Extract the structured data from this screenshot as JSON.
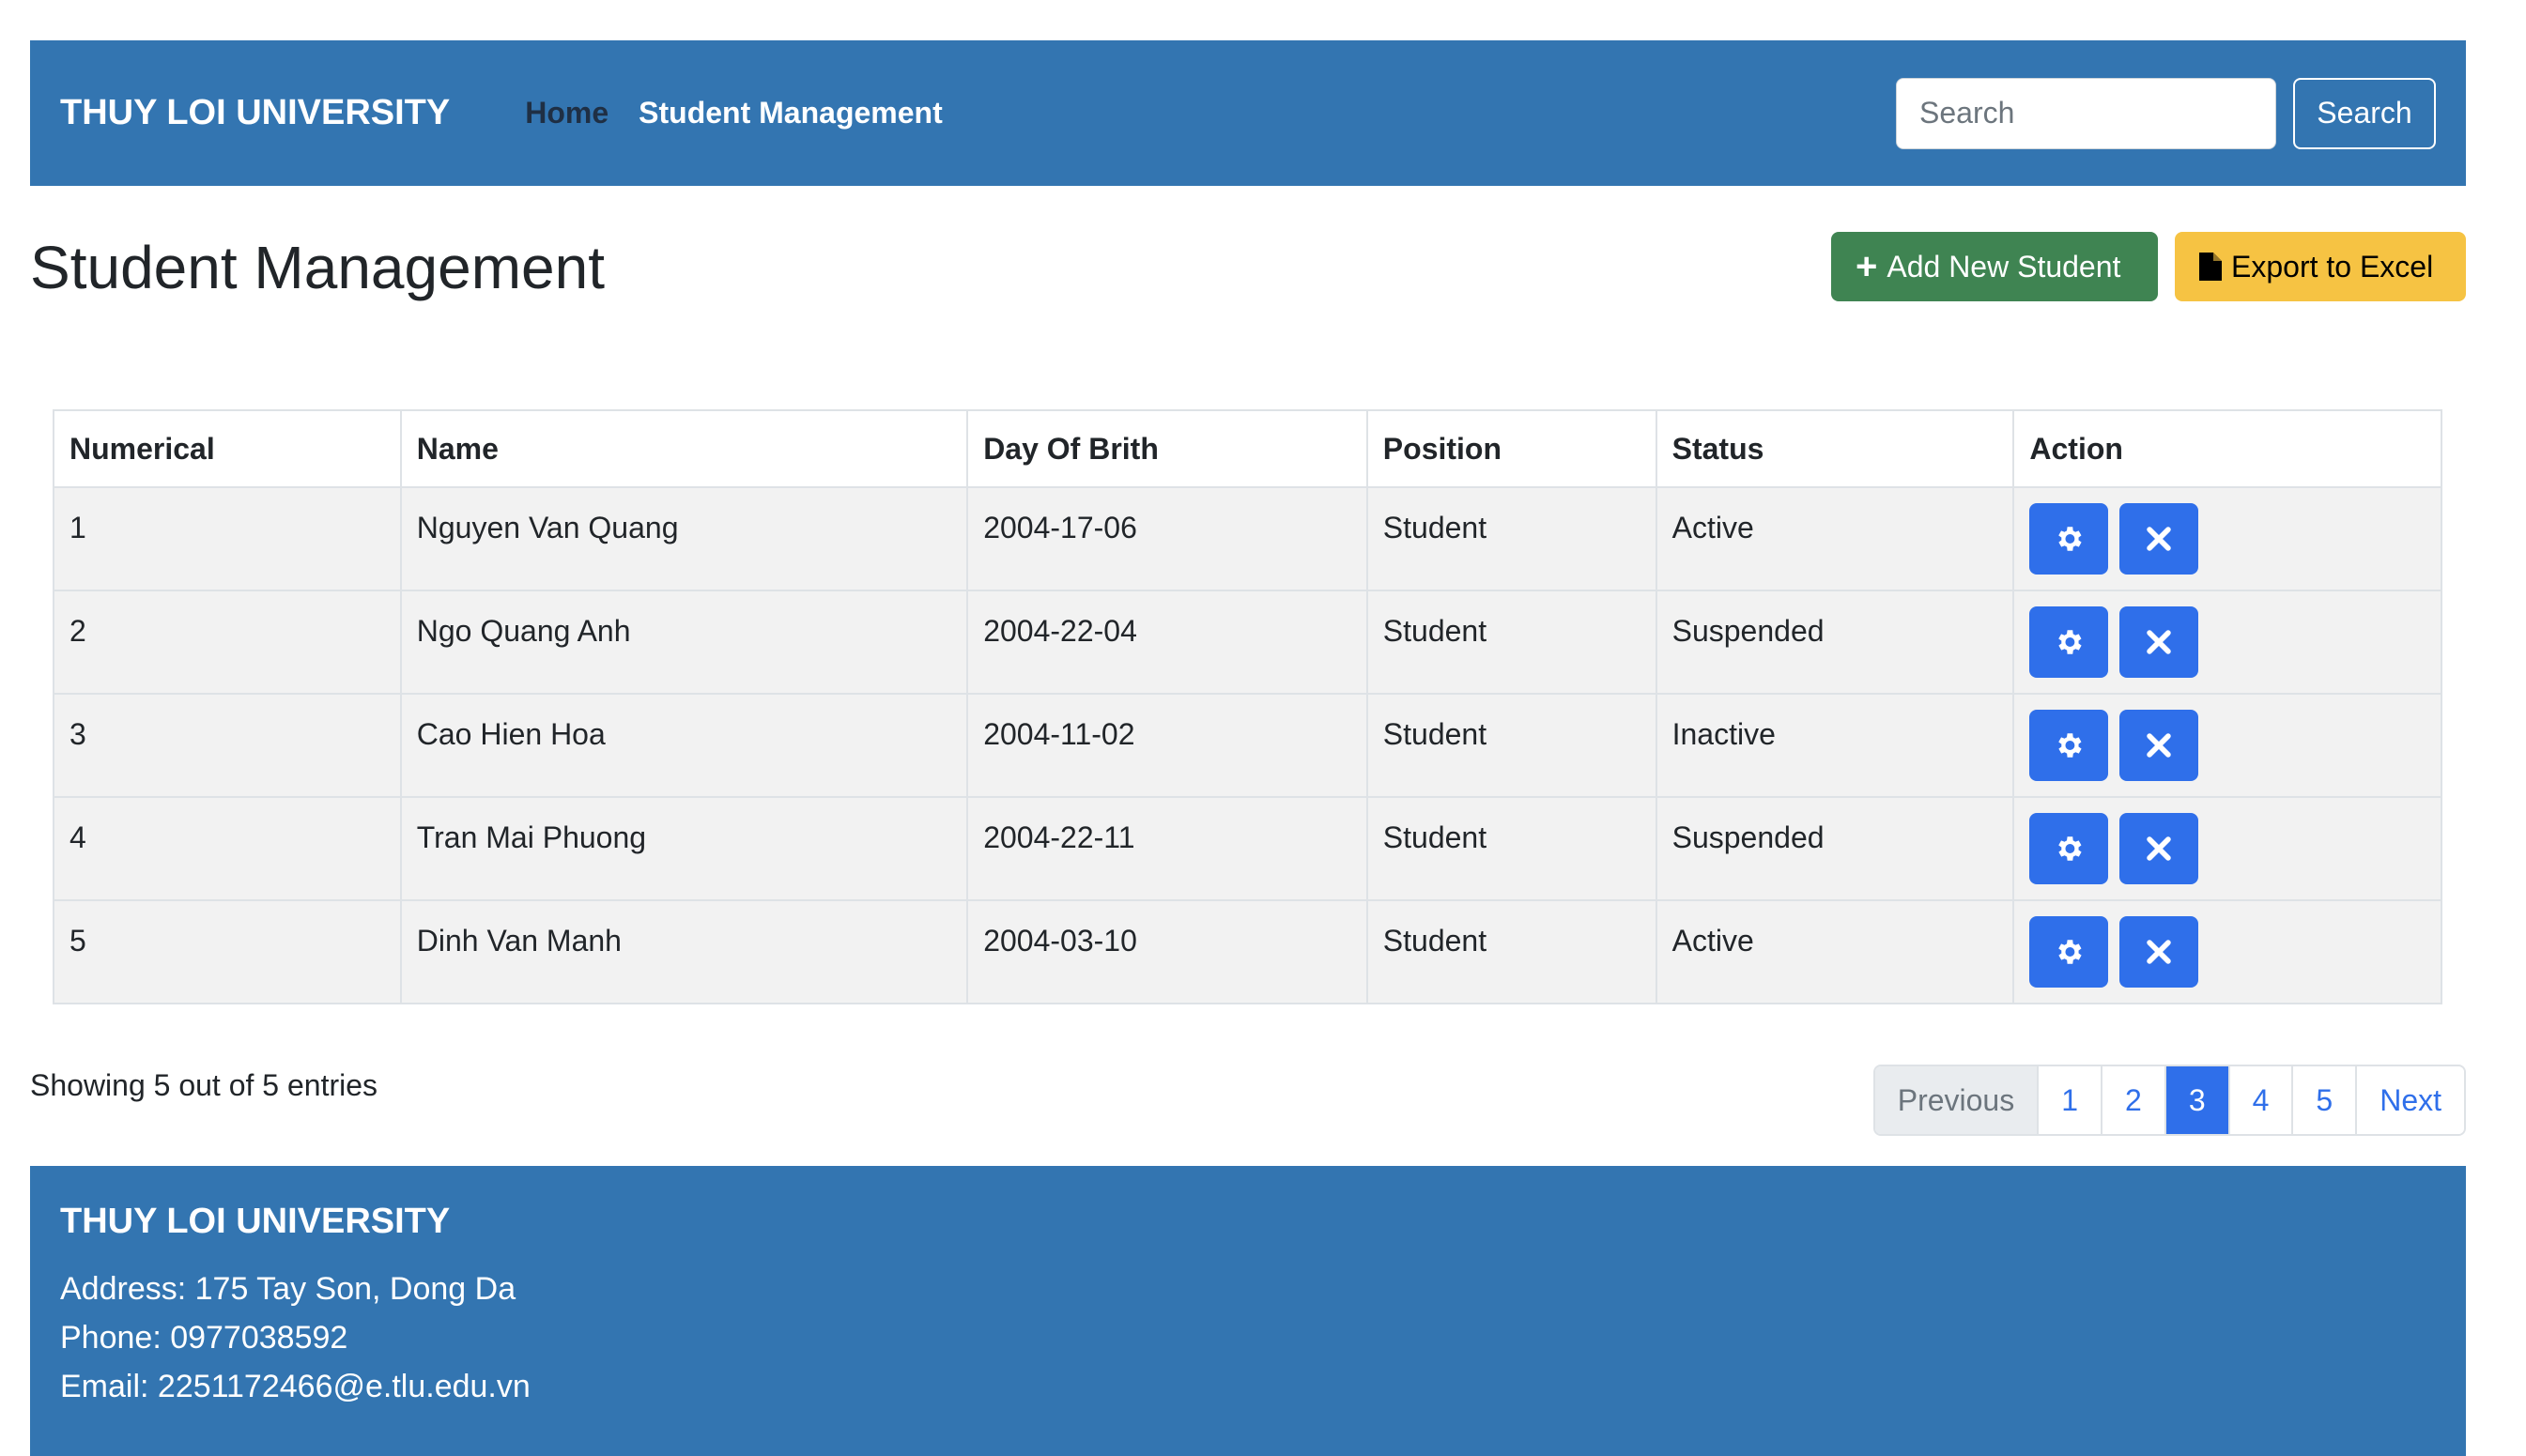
{
  "navbar": {
    "brand": "THUY LOI UNIVERSITY",
    "links": [
      {
        "label": "Home"
      },
      {
        "label": "Student Management"
      }
    ],
    "search_placeholder": "Search",
    "search_button": "Search"
  },
  "page": {
    "title": "Student Management",
    "add_button": "Add New Student",
    "export_button": "Export to Excel"
  },
  "table": {
    "headers": [
      "Numerical",
      "Name",
      "Day Of Brith",
      "Position",
      "Status",
      "Action"
    ],
    "rows": [
      {
        "num": "1",
        "name": "Nguyen Van Quang",
        "dob": "2004-17-06",
        "position": "Student",
        "status": "Active"
      },
      {
        "num": "2",
        "name": "Ngo Quang Anh",
        "dob": "2004-22-04",
        "position": "Student",
        "status": "Suspended"
      },
      {
        "num": "3",
        "name": "Cao Hien Hoa",
        "dob": "2004-11-02",
        "position": "Student",
        "status": "Inactive"
      },
      {
        "num": "4",
        "name": "Tran Mai Phuong",
        "dob": "2004-22-11",
        "position": "Student",
        "status": "Suspended"
      },
      {
        "num": "5",
        "name": "Dinh Van Manh",
        "dob": "2004-03-10",
        "position": "Student",
        "status": "Active"
      }
    ],
    "row_actions": {
      "edit_icon": "gear-icon",
      "delete_icon": "close-icon"
    }
  },
  "entries_info": "Showing 5 out of 5 entries",
  "pagination": {
    "previous": "Previous",
    "pages": [
      "1",
      "2",
      "3",
      "4",
      "5"
    ],
    "active_page": "3",
    "next": "Next"
  },
  "footer": {
    "brand": "THUY LOI UNIVERSITY",
    "address": "Address: 175 Tay Son, Dong Da",
    "phone": "Phone: 0977038592",
    "email": "Email: 2251172466@e.tlu.edu.vn"
  },
  "colors": {
    "brand_blue": "#3375b1",
    "success": "#3f8452",
    "warning": "#f6c343",
    "primary": "#2f6fea"
  }
}
